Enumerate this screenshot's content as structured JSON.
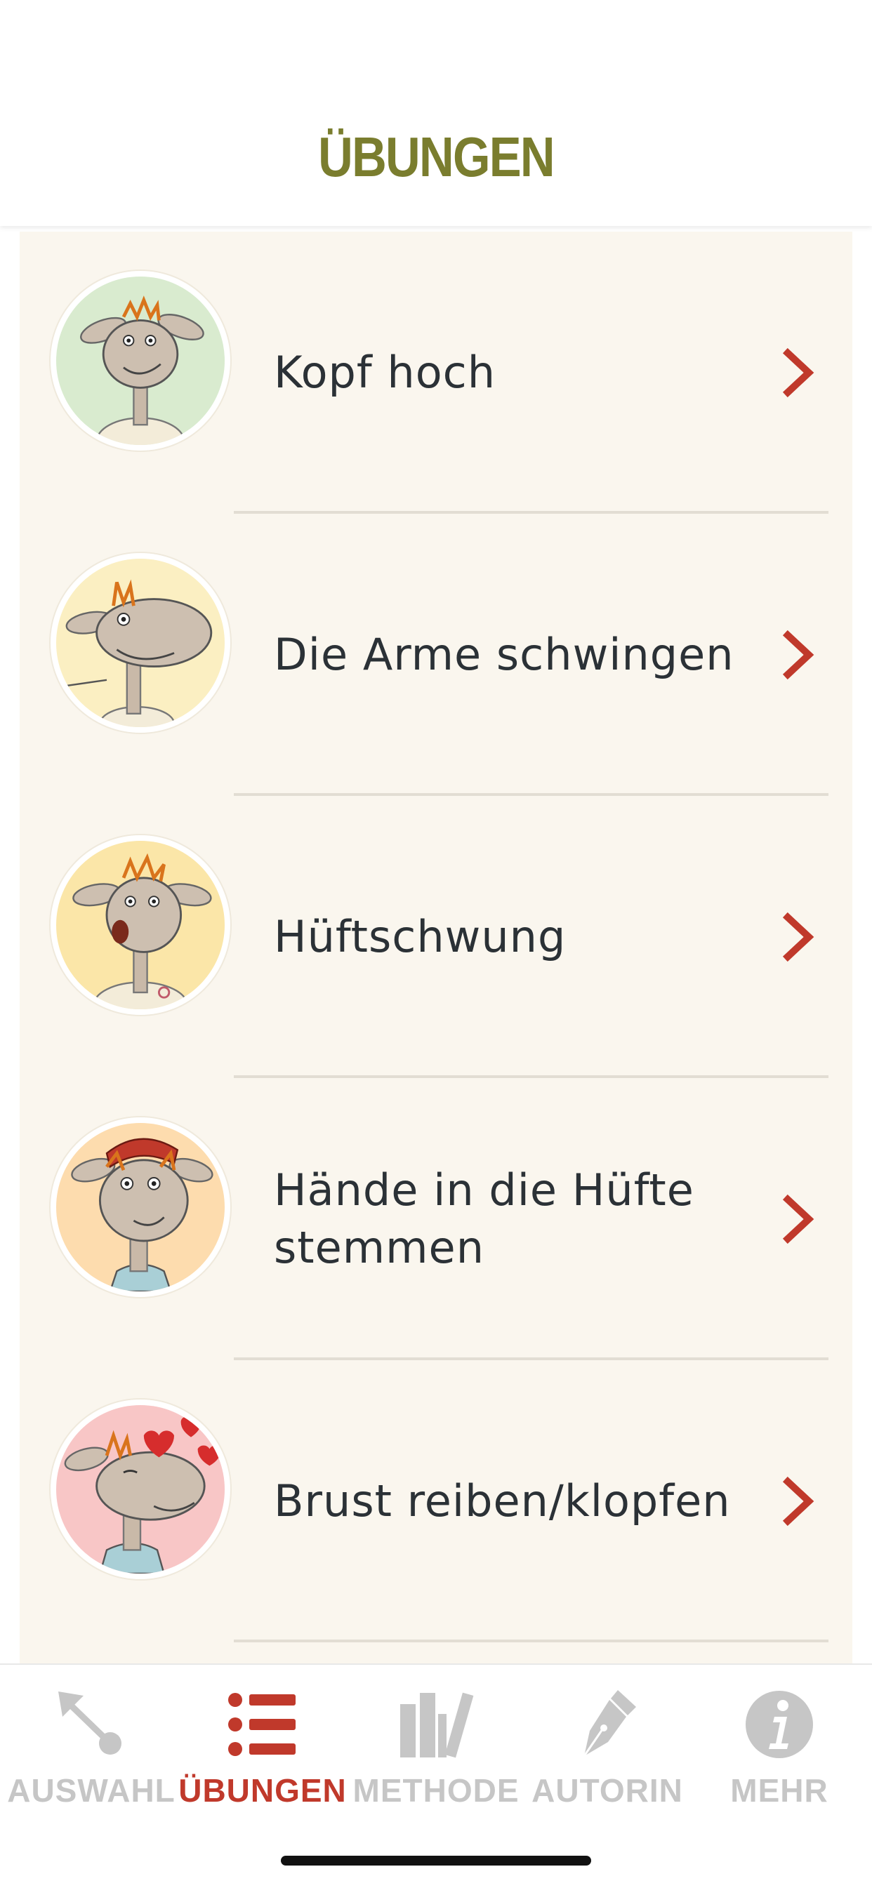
{
  "header": {
    "title": "ÜBUNGEN",
    "title_color": "#7a7d2e"
  },
  "exercises": [
    {
      "label": "Kopf hoch",
      "avatar_icon": "sheep-head-up-icon",
      "avatar_bg": "#d9ebcf"
    },
    {
      "label": "Die Arme schwingen",
      "avatar_icon": "sheep-swinging-arms-icon",
      "avatar_bg": "#fbefc2"
    },
    {
      "label": "Hüftschwung",
      "avatar_icon": "sheep-hip-swing-icon",
      "avatar_bg": "#fbe6a8"
    },
    {
      "label": "Hände in die Hüfte stemmen",
      "avatar_icon": "sheep-hands-on-hips-icon",
      "avatar_bg": "#fddcae"
    },
    {
      "label": "Brust reiben/klopfen",
      "avatar_icon": "sheep-chest-rub-icon",
      "avatar_bg": "#f8c6c6"
    }
  ],
  "tabs": [
    {
      "label": "AUSWAHL",
      "icon": "arrow-pin-icon",
      "active": false
    },
    {
      "label": "ÜBUNGEN",
      "icon": "list-icon",
      "active": true
    },
    {
      "label": "METHODE",
      "icon": "books-icon",
      "active": false
    },
    {
      "label": "AUTORIN",
      "icon": "fountain-pen-icon",
      "active": false
    },
    {
      "label": "MEHR",
      "icon": "info-icon",
      "active": false
    }
  ],
  "colors": {
    "accent": "#c0392b",
    "inactive": "#c6c6c6",
    "list_background": "#faf6ee",
    "text": "#2b3136"
  }
}
